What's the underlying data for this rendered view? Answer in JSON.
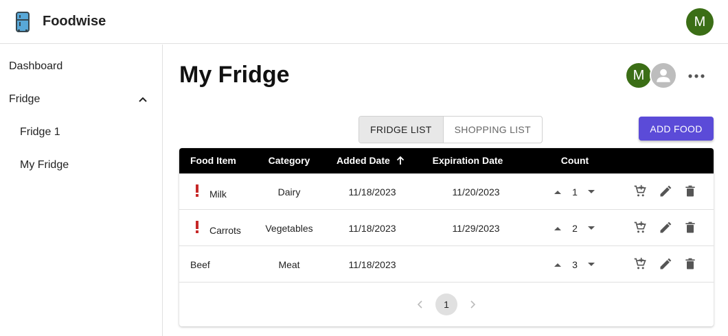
{
  "app": {
    "name": "Foodwise",
    "user_initial": "M",
    "colors": {
      "avatar": "#3b6e16",
      "accent": "#5b4bd8",
      "warning": "#c62828",
      "header": "#000000",
      "fridge_blue": "#58a8d8"
    }
  },
  "sidebar": {
    "items": [
      {
        "label": "Dashboard"
      },
      {
        "label": "Fridge",
        "expanded": true,
        "icon": "chevron-up-icon"
      },
      {
        "label": "Fridge 1"
      },
      {
        "label": "My Fridge"
      }
    ]
  },
  "main": {
    "title": "My Fridge",
    "member_initial": "M",
    "tabs": [
      {
        "label": "FRIDGE LIST",
        "active": true
      },
      {
        "label": "SHOPPING LIST",
        "active": false
      }
    ],
    "add_button": "ADD FOOD"
  },
  "table": {
    "columns": [
      "Food Item",
      "Category",
      "Added Date",
      "Expiration Date",
      "Count"
    ],
    "sort": {
      "column": "Added Date",
      "direction": "ascending"
    },
    "rows": [
      {
        "warning": true,
        "item": "Milk",
        "category": "Dairy",
        "added": "11/18/2023",
        "expiration": "11/20/2023",
        "count": "1"
      },
      {
        "warning": true,
        "item": "Carrots",
        "category": "Vegetables",
        "added": "11/18/2023",
        "expiration": "11/29/2023",
        "count": "2"
      },
      {
        "warning": false,
        "item": "Beef",
        "category": "Meat",
        "added": "11/18/2023",
        "expiration": "",
        "count": "3"
      }
    ],
    "row_actions": [
      "add-to-cart-icon",
      "edit-icon",
      "delete-icon"
    ]
  },
  "pagination": {
    "current_page": "1"
  }
}
